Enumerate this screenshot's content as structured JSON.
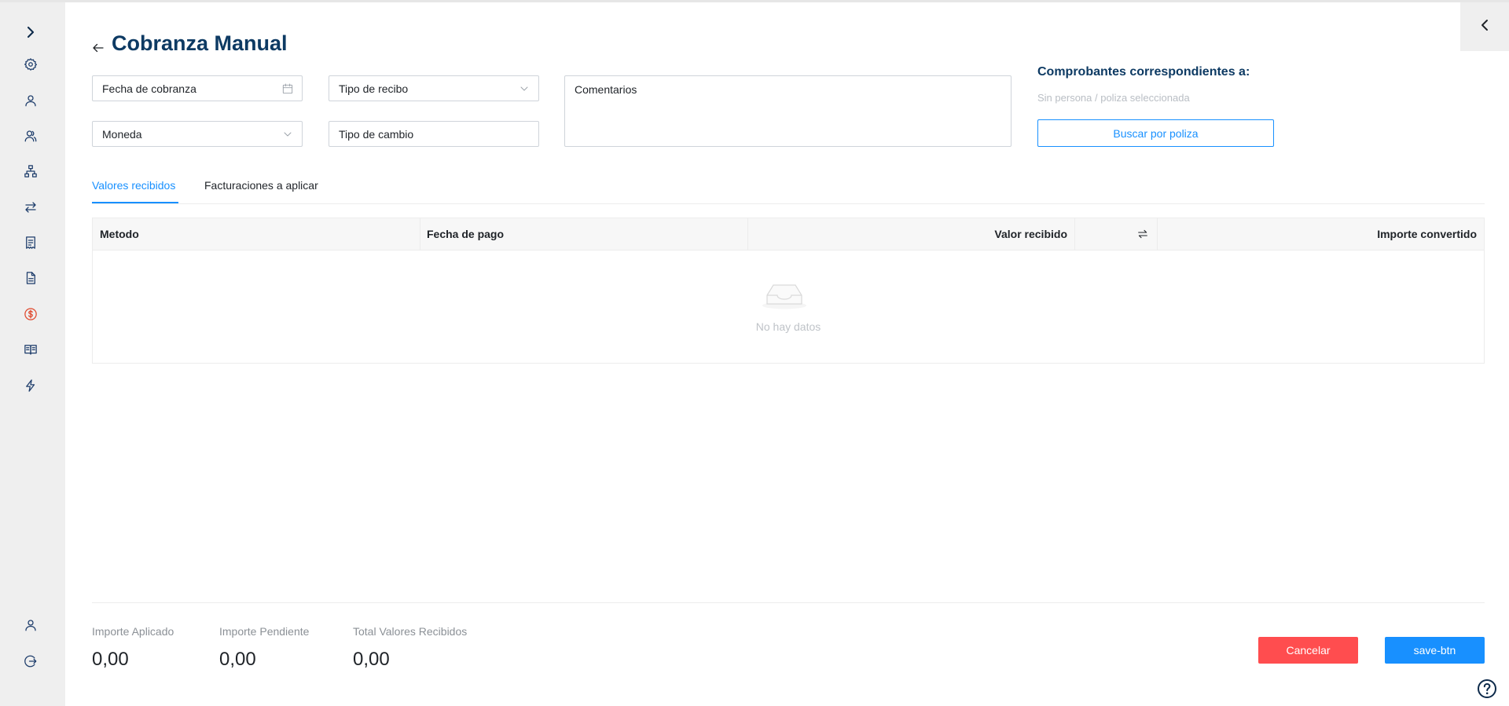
{
  "page": {
    "title": "Cobranza Manual"
  },
  "form": {
    "fecha_cobranza_placeholder": "Fecha de cobranza",
    "tipo_recibo_placeholder": "Tipo de recibo",
    "moneda_placeholder": "Moneda",
    "tipo_cambio_placeholder": "Tipo de cambio",
    "comentarios_placeholder": "Comentarios"
  },
  "comprobantes": {
    "title": "Comprobantes correspondientes a:",
    "subtitle": "Sin persona / poliza seleccionada",
    "search_button": "Buscar por poliza"
  },
  "tabs": [
    {
      "label": "Valores recibidos",
      "active": true
    },
    {
      "label": "Facturaciones a aplicar",
      "active": false
    }
  ],
  "table": {
    "columns": [
      "Metodo",
      "Fecha de pago",
      "Valor recibido",
      "Importe convertido"
    ],
    "rows": [],
    "empty_text": "No hay datos"
  },
  "summary": {
    "importe_aplicado_label": "Importe Aplicado",
    "importe_aplicado_value": "0,00",
    "importe_pendiente_label": "Importe Pendiente",
    "importe_pendiente_value": "0,00",
    "total_valores_label": "Total Valores Recibidos",
    "total_valores_value": "0,00"
  },
  "actions": {
    "cancel_label": "Cancelar",
    "save_label": "save-btn"
  },
  "colors": {
    "primary": "#1890ff",
    "danger": "#ff4d4f",
    "title": "#0d3a63",
    "sidebar_bg": "#efefef",
    "active_icon": "#e04a2f"
  },
  "sidebar": {
    "icons": [
      "expand-chevron-icon",
      "gear-icon",
      "user-icon",
      "users-icon",
      "hierarchy-icon",
      "transfer-icon",
      "receipt-icon",
      "document-icon",
      "dollar-circle-icon",
      "book-icon",
      "lightning-icon",
      "profile-icon",
      "logout-icon"
    ],
    "active": "dollar-circle-icon"
  }
}
